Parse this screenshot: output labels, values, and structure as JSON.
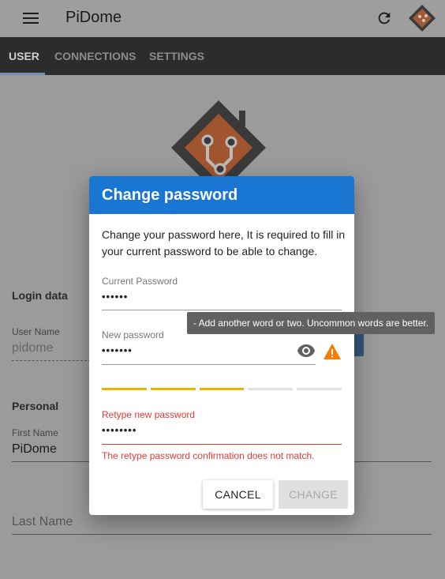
{
  "app": {
    "title": "PiDome"
  },
  "tabs": [
    {
      "label": "USER",
      "active": true
    },
    {
      "label": "CONNECTIONS",
      "active": false
    },
    {
      "label": "SETTINGS",
      "active": false
    }
  ],
  "background": {
    "login_section": "Login data",
    "user_name_label": "User Name",
    "user_name_value": "pidome",
    "personal_section": "Personal",
    "first_name_label": "First Name",
    "first_name_value": "PiDome",
    "last_name_placeholder": "Last Name"
  },
  "dialog": {
    "title": "Change password",
    "description": "Change your password here, It is required to fill in your current password to be able to change.",
    "current_password": {
      "label": "Current Password",
      "value": "••••••"
    },
    "new_password": {
      "label": "New password",
      "value": "•••••••"
    },
    "strength": {
      "filled": 3,
      "total": 5
    },
    "retype_password": {
      "label": "Retype new password",
      "value": "••••••••"
    },
    "error": "The retype password confirmation does not match.",
    "cancel_label": "CANCEL",
    "change_label": "CHANGE"
  },
  "tooltip": "- Add another word or two. Uncommon words are better.",
  "icons": {
    "menu": "menu-icon",
    "refresh": "refresh-icon",
    "visibility": "eye-icon",
    "warning": "warning-icon"
  },
  "colors": {
    "primary": "#1976d2",
    "warning": "#f57c00",
    "strength": "#f0b400",
    "error": "#e53935"
  }
}
